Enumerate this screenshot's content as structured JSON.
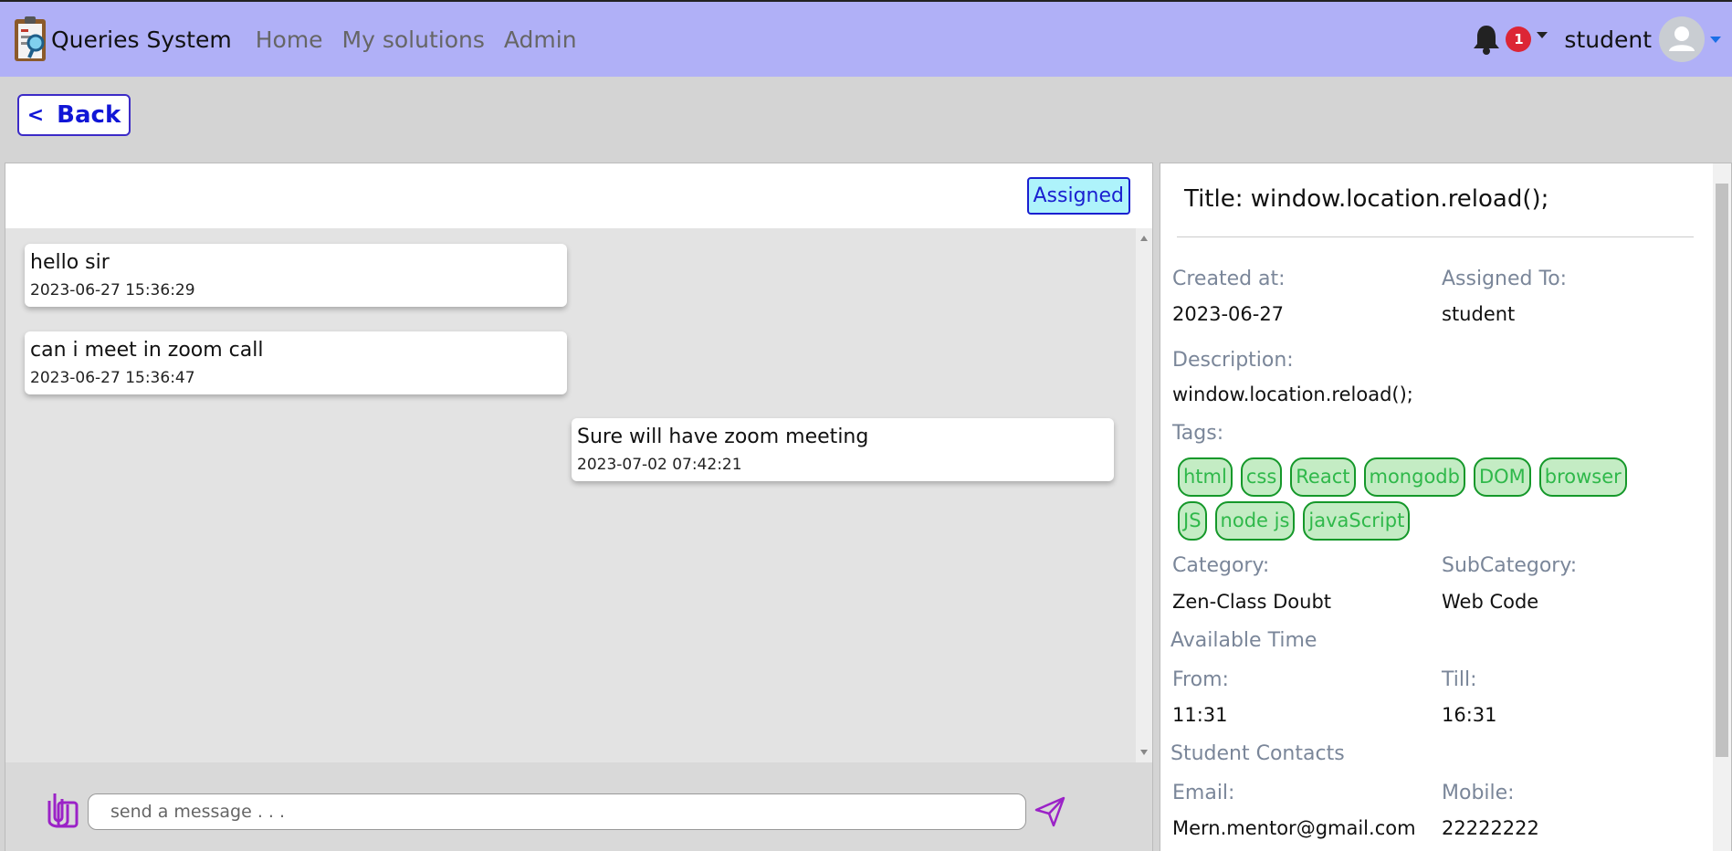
{
  "navbar": {
    "brand": "Queries System",
    "links": [
      "Home",
      "My solutions",
      "Admin"
    ],
    "notification_count": "1",
    "user": "student"
  },
  "back": {
    "arrow": "<",
    "label": "Back"
  },
  "chat": {
    "status": "Assigned",
    "messages": [
      {
        "text": "hello sir",
        "time": "2023-06-27 15:36:29"
      },
      {
        "text": "can i meet in zoom call",
        "time": "2023-06-27 15:36:47"
      },
      {
        "text": "Sure will have zoom meeting",
        "time": "2023-07-02 07:42:21"
      }
    ],
    "input_placeholder": "send a message . . ."
  },
  "details": {
    "title": "Title: window.location.reload();",
    "created_label": "Created at:",
    "created_value": "2023-06-27",
    "assigned_label": "Assigned To:",
    "assigned_value": "student",
    "description_label": "Description:",
    "description_value": "window.location.reload();",
    "tags_label": "Tags:",
    "tags": [
      "html",
      "css",
      "React",
      "mongodb",
      "DOM",
      "browser",
      "JS",
      "node js",
      "javaScript"
    ],
    "category_label": "Category:",
    "category_value": "Zen-Class Doubt",
    "subcategory_label": "SubCategory:",
    "subcategory_value": "Web Code",
    "available_label": "Available Time",
    "from_label": "From:",
    "from_value": "11:31",
    "till_label": "Till:",
    "till_value": "16:31",
    "contacts_label": "Student Contacts",
    "email_label": "Email:",
    "email_value": "Mern.mentor@gmail.com",
    "mobile_label": "Mobile:",
    "mobile_value": "22222222"
  },
  "colors": {
    "navbar_bg": "#b0b0f7",
    "accent": "#3c2bc7",
    "tag_border": "#15982a",
    "badge": "#dc2535"
  },
  "icons": [
    "app-logo-icon",
    "bell-icon",
    "avatar-icon",
    "attach-icon",
    "send-icon"
  ]
}
